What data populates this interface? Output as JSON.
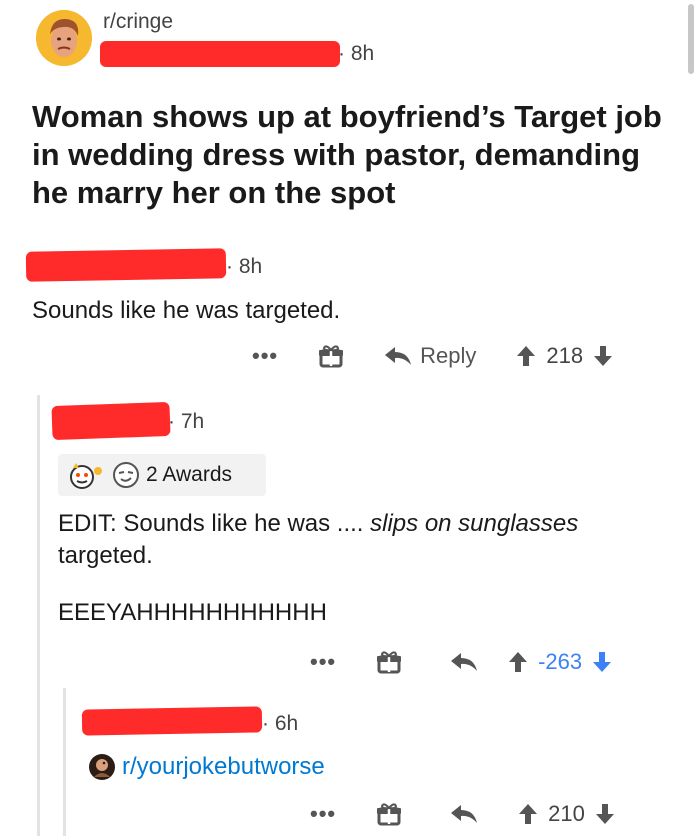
{
  "post": {
    "subreddit": "r/cringe",
    "age": "8h",
    "title": "Woman shows up at boyfriend’s Target job in wedding dress with pastor, demanding he marry her on the spot"
  },
  "comment1": {
    "age": "8h",
    "body": "Sounds like he was targeted.",
    "reply_label": "Reply",
    "score": "218",
    "more": "•••"
  },
  "comment2": {
    "age": "7h",
    "awards_label": "2 Awards",
    "edit_prefix": "EDIT: Sounds like he was .... ",
    "edit_italic": "slips on sunglasses",
    "edit_suffix": "targeted.",
    "shout": "EEEYAHHHHHHHHHHH",
    "score": "-263",
    "more": "•••"
  },
  "comment3": {
    "age": "6h",
    "subreddit_link": "r/yourjokebutworse",
    "score": "210",
    "more": "•••"
  },
  "colors": {
    "redaction": "#ff2b2b",
    "downvote_active": "#3b82f6",
    "link": "#0079d3"
  },
  "icons": [
    "avatar",
    "gift-icon",
    "reply-arrow-icon",
    "upvote-icon",
    "downvote-icon",
    "award-icon",
    "subreddit-avatar-icon"
  ]
}
